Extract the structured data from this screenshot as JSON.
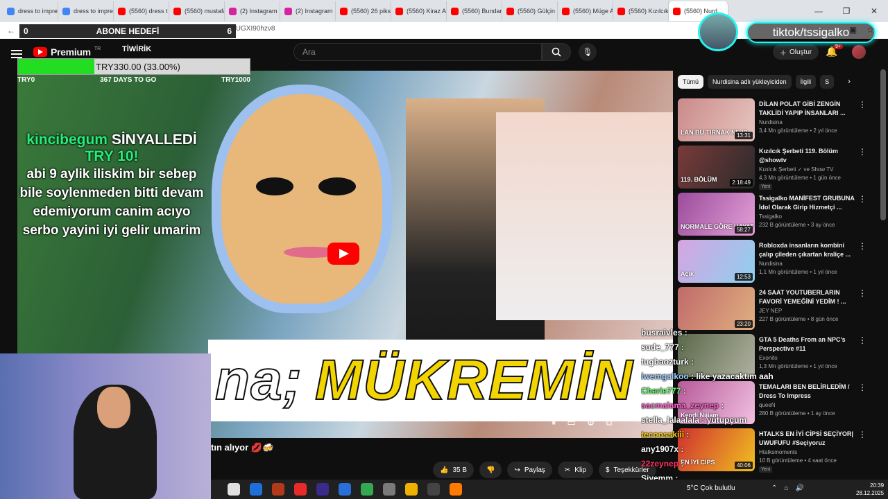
{
  "browser": {
    "tabs": [
      {
        "label": "dress to impre",
        "icon": "google-icon",
        "color": "#4285f4"
      },
      {
        "label": "dress to impre",
        "icon": "google-icon",
        "color": "#4285f4"
      },
      {
        "label": "(5560) dress t",
        "icon": "youtube-icon",
        "color": "#ff0000"
      },
      {
        "label": "(5560) mustafa",
        "icon": "youtube-icon",
        "color": "#ff0000"
      },
      {
        "label": "(2) Instagram",
        "icon": "instagram-icon",
        "color": "#d6249f"
      },
      {
        "label": "(2) Instagram",
        "icon": "instagram-icon",
        "color": "#d6249f"
      },
      {
        "label": "(5560) 26 piks",
        "icon": "youtube-icon",
        "color": "#ff0000"
      },
      {
        "label": "(5560) Kiraz A",
        "icon": "youtube-icon",
        "color": "#ff0000"
      },
      {
        "label": "(5560) Bundar",
        "icon": "youtube-icon",
        "color": "#ff0000"
      },
      {
        "label": "(5560) Gülçin",
        "icon": "youtube-icon",
        "color": "#ff0000"
      },
      {
        "label": "(5560) Müge A",
        "icon": "youtube-icon",
        "color": "#ff0000"
      },
      {
        "label": "(5560) Kızılcık",
        "icon": "youtube-icon",
        "color": "#ff0000"
      },
      {
        "label": "(5560) Nurd",
        "icon": "youtube-icon",
        "color": "#ff0000",
        "active": true
      }
    ],
    "url": "youtube.com/watch?v=DUGXI90hzv8"
  },
  "overlay": {
    "sub_goal_label": "ABONE HEDEFİ",
    "sub_goal_current": "0",
    "sub_goal_target": "6",
    "tiktok_handle": "tiktok/tssigalko",
    "donation_goal_text": "TRY330.00 (33.00%)",
    "donation_goal_fraction": 0.33,
    "donation_start": "TRY0",
    "donation_days": "367 DAYS TO GO",
    "donation_end": "TRY1000",
    "channel_tag": "TİWİRİK"
  },
  "alert": {
    "user": "kincibegum",
    "verb": "SİNYALLEDİ",
    "amount": "TRY 10!",
    "message": "abi 9 aylik iliskim bir sebep bile soylenmeden bitti devam edemiyorum canim acıyo serbo yayini iyi gelir umarim"
  },
  "youtube": {
    "logo": "Premium",
    "region": "TR",
    "search_placeholder": "Ara",
    "create_label": "Oluştur",
    "notif_count": "9+",
    "video_caption": "MÜKREMİN",
    "video_caption_prefix": "na;",
    "title_partial": "tın alıyor 💋🍻",
    "like_count": "35 B",
    "share_label": "Paylaş",
    "clip_label": "Klip",
    "thanks_label": "Teşekkürler",
    "chips": [
      "Tümü",
      "Nurdisina adlı yükleyiciden",
      "İlgili",
      "S"
    ]
  },
  "recommendations": [
    {
      "title": "DİLAN POLAT GİBİ ZENGİN TAKLİDİ YAPIP İNSANLARI ...",
      "channel": "Nurdisina",
      "meta": "3,4 Mn görüntüleme • 2 yıl önce",
      "duration": "13:31",
      "caption": "LAN BU TIRNAK NE !?",
      "colors": [
        "#c98a8a",
        "#e8c6c0"
      ]
    },
    {
      "title": "Kızılcık Şerbeti 119. Bölüm @showtv",
      "channel": "Kızılcık Şerbeti ✓ ve Show TV",
      "meta": "4,3 Mn görüntüleme • 1 gün önce",
      "duration": "2:18:49",
      "caption": "119. BÖLÜM",
      "new": "Yeni",
      "colors": [
        "#7a3a3a",
        "#2a2a2a"
      ]
    },
    {
      "title": "Tssigalko MANİFEST GRUBUNA İdol Olarak Girip Hizmetçi ...",
      "channel": "Tssigalko",
      "meta": "232 B görüntüleme • 3 ay önce",
      "duration": "58:27",
      "caption": "NORMALE GÖRE HAYAT",
      "colors": [
        "#9b4c9b",
        "#e3a0d8"
      ]
    },
    {
      "title": "Robloxda insanların kombini çalıp çileden çıkartan kraliçe ...",
      "channel": "Nurdisina",
      "meta": "1,1 Mn görüntüleme • 1 yıl önce",
      "duration": "12:53",
      "caption": "Açık",
      "colors": [
        "#d7a4e0",
        "#8ed0f0"
      ]
    },
    {
      "title": "24 SAAT YOUTUBERLARIN FAVORİ YEMEĞİNİ YEDİM ! ...",
      "channel": "JEY NEP",
      "meta": "227 B görüntüleme • 8 gün önce",
      "duration": "23:20",
      "caption": "",
      "colors": [
        "#c06a6a",
        "#e0b080"
      ]
    },
    {
      "title": "GTA 5 Deaths From an NPC's Perspective #11",
      "channel": "Exonito",
      "meta": "1,3 Mn görüntüleme • 1 yıl önce",
      "duration": "",
      "caption": "",
      "colors": [
        "#5a6a4a",
        "#b0b0a0"
      ]
    },
    {
      "title": "TEMALARI BEN BELİRLEDİM / Dress To Impress",
      "channel": "queeN",
      "meta": "280 B görüntüleme • 1 ay önce",
      "duration": "",
      "caption": "Kendi Nijiam",
      "colors": [
        "#b85a9a",
        "#f0c0e0"
      ]
    },
    {
      "title": "HTALKS EN İYİ CİPSİ SEÇİYOR| UWUFUFU #Seçiyoruz",
      "channel": "Htalksmoments",
      "meta": "10 B görüntüleme • 4 saat önce",
      "duration": "40:06",
      "caption": "EN İYİ CİPS",
      "new": "Yeni",
      "colors": [
        "#d03030",
        "#f0c020"
      ]
    }
  ],
  "chat": [
    {
      "user": "busraivles",
      "msg": "",
      "color": "#ffffff"
    },
    {
      "user": "sude_777",
      "msg": "",
      "color": "#ffffff"
    },
    {
      "user": "tugbaozturk",
      "msg": "",
      "color": "#ffffff"
    },
    {
      "user": "iwemgalkoo",
      "msg": "like yazacaktım aahkswldj",
      "color": "#9fd0ff"
    },
    {
      "user": "Cherie777",
      "msg": "",
      "color": "#66ff66"
    },
    {
      "user": "sacmalama_zeynep",
      "msg": "",
      "color": "#ff66cc"
    },
    {
      "user": "stella_lalaalala",
      "msg": "yutupçum",
      "color": "#ffffff"
    },
    {
      "user": "tecoosskiii",
      "msg": "",
      "color": "#ffcc00"
    },
    {
      "user": "any1907x",
      "msg": "",
      "color": "#ffffff"
    },
    {
      "user": "22zeynep",
      "msg": "",
      "color": "#ff3366"
    },
    {
      "user": "Siyemm",
      "msg": "",
      "color": "#ffffff"
    }
  ],
  "taskbar": {
    "weather": "5°C  Çok bulutlu",
    "time": "20:39",
    "date": "28.12.2025",
    "icon_colors": [
      "#e0e0e0",
      "#1e6fd9",
      "#b23a1a",
      "#e82a2a",
      "#3a2a8a",
      "#2a6fd9",
      "#34a853",
      "#7a7a7a",
      "#f0b000",
      "#444",
      "#ff7a00"
    ]
  }
}
